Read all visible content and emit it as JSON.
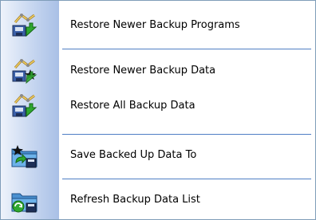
{
  "menu": {
    "items": [
      {
        "label": "Restore Newer Backup Programs",
        "icon": "restore-programs-icon"
      },
      {
        "label": "Restore Newer Backup Data",
        "icon": "restore-data-icon"
      },
      {
        "label": "Restore All Backup Data",
        "icon": "restore-all-icon"
      },
      {
        "label": "Save Backed Up Data To",
        "icon": "save-folder-icon"
      },
      {
        "label": "Refresh Backup Data List",
        "icon": "refresh-folder-icon"
      }
    ]
  }
}
